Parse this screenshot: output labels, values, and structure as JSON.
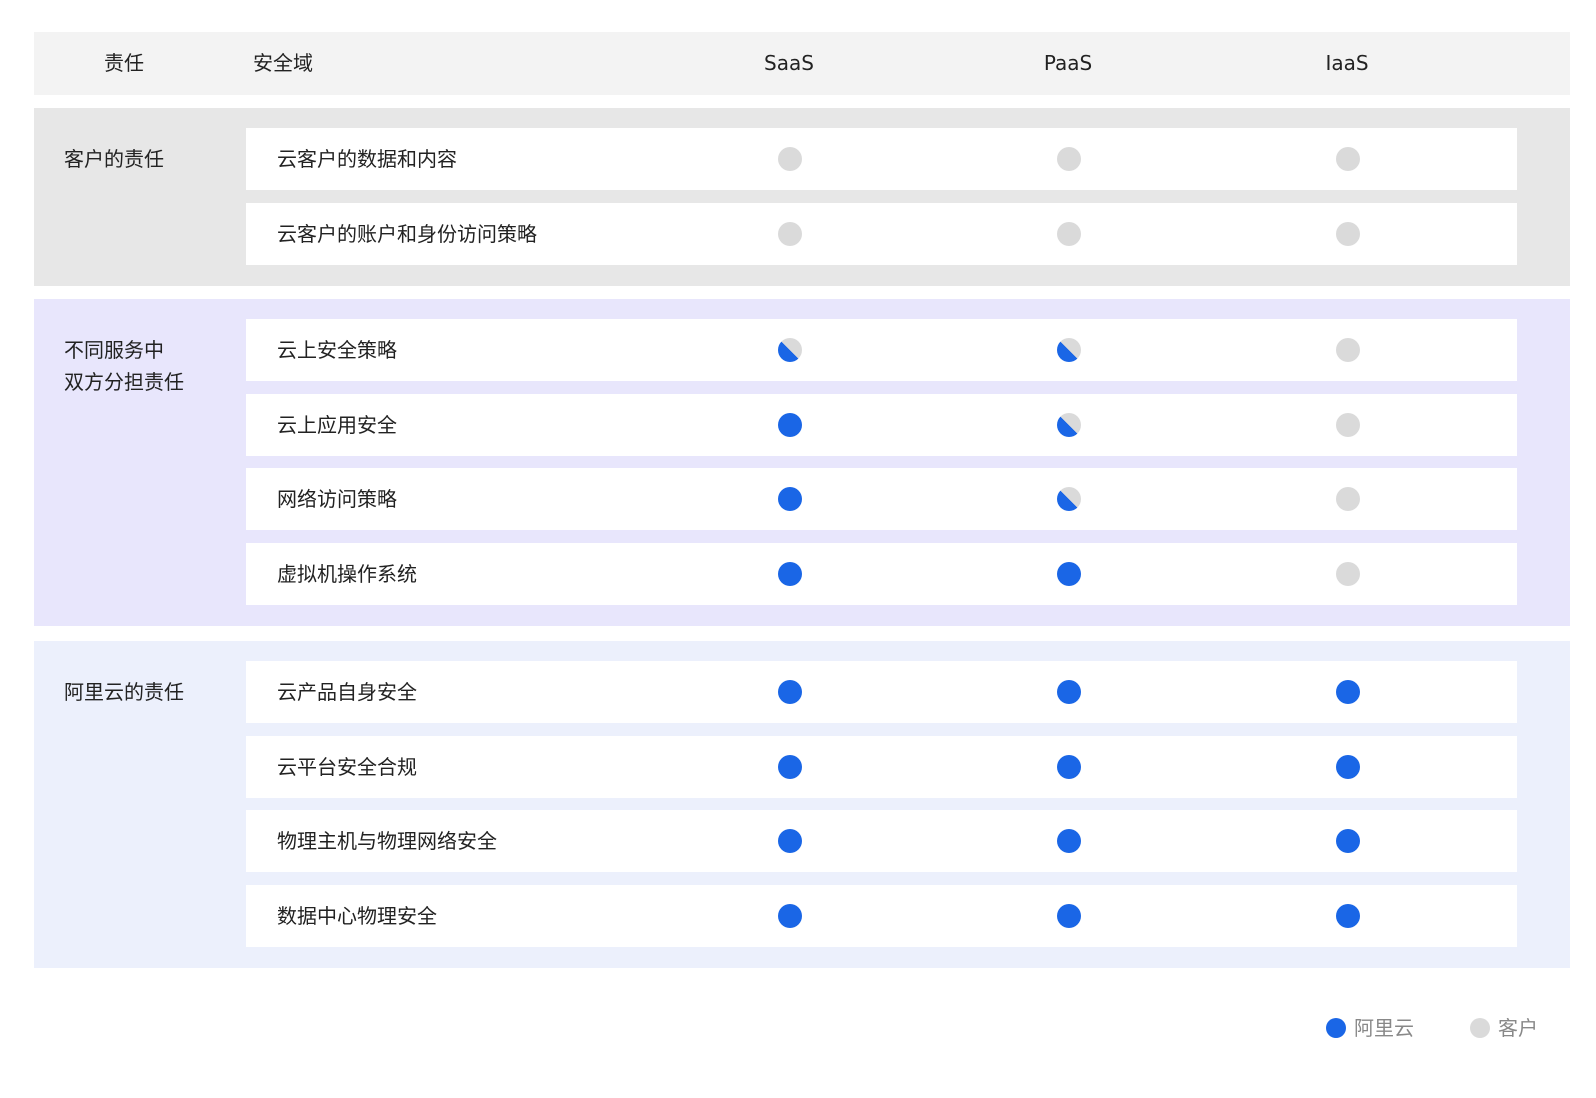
{
  "chart_data": {
    "type": "table",
    "columns": {
      "responsibility": "责任",
      "security_domain": "安全域",
      "models": [
        "SaaS",
        "PaaS",
        "IaaS"
      ]
    },
    "groups": [
      {
        "label_lines": [
          "客户的责任"
        ],
        "rows": [
          {
            "label": "云客户的数据和内容",
            "values": [
              "客户",
              "客户",
              "客户"
            ]
          },
          {
            "label": "云客户的账户和身份访问策略",
            "values": [
              "客户",
              "客户",
              "客户"
            ]
          }
        ]
      },
      {
        "label_lines": [
          "不同服务中",
          "双方分担责任"
        ],
        "rows": [
          {
            "label": "云上安全策略",
            "values": [
              "shared",
              "shared",
              "客户"
            ]
          },
          {
            "label": "云上应用安全",
            "values": [
              "阿里云",
              "shared",
              "客户"
            ]
          },
          {
            "label": "网络访问策略",
            "values": [
              "阿里云",
              "shared",
              "客户"
            ]
          },
          {
            "label": "虚拟机操作系统",
            "values": [
              "阿里云",
              "阿里云",
              "客户"
            ]
          }
        ]
      },
      {
        "label_lines": [
          "阿里云的责任"
        ],
        "rows": [
          {
            "label": "云产品自身安全",
            "values": [
              "阿里云",
              "阿里云",
              "阿里云"
            ]
          },
          {
            "label": "云平台安全合规",
            "values": [
              "阿里云",
              "阿里云",
              "阿里云"
            ]
          },
          {
            "label": "物理主机与物理网络安全",
            "values": [
              "阿里云",
              "阿里云",
              "阿里云"
            ]
          },
          {
            "label": "数据中心物理安全",
            "values": [
              "阿里云",
              "阿里云",
              "阿里云"
            ]
          }
        ]
      }
    ],
    "legend": [
      {
        "label": "阿里云",
        "color": "#1a66e6"
      },
      {
        "label": "客户",
        "color": "#dadada"
      }
    ],
    "legend_position": "bottom-right"
  },
  "colors": {
    "alibaba": "#1a66e6",
    "customer": "#dadada",
    "group_customer_bg": "#e7e7e7",
    "group_shared_bg": "#e8e6fc",
    "group_alibaba_bg": "#ecf0fc",
    "header_bg": "#f3f3f3"
  }
}
